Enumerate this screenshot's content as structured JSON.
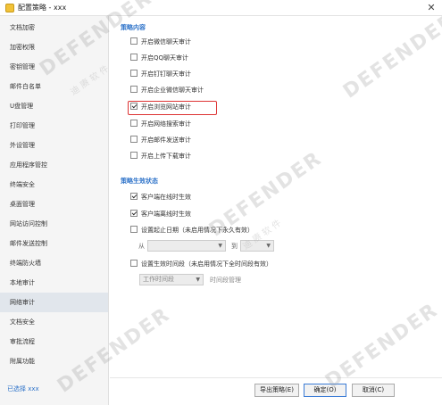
{
  "window": {
    "title": "配置策略 - xxx",
    "close_label": "✕"
  },
  "sidebar": {
    "items": [
      {
        "label": "文档加密"
      },
      {
        "label": "加密权限"
      },
      {
        "label": "密钥管理"
      },
      {
        "label": "邮件白名单"
      },
      {
        "label": "U盘管理"
      },
      {
        "label": "打印管理"
      },
      {
        "label": "外设管理"
      },
      {
        "label": "应用程序管控"
      },
      {
        "label": "终端安全"
      },
      {
        "label": "桌面管理"
      },
      {
        "label": "网站访问控制"
      },
      {
        "label": "邮件发送控制"
      },
      {
        "label": "终端防火墙"
      },
      {
        "label": "本地审计"
      },
      {
        "label": "网络审计"
      },
      {
        "label": "文档安全"
      },
      {
        "label": "审批流程"
      },
      {
        "label": "附属功能"
      }
    ],
    "active_index": 14,
    "footer": "已选择 xxx"
  },
  "policy_content": {
    "title": "策略内容",
    "items": [
      {
        "label": "开启微信聊天审计",
        "checked": false
      },
      {
        "label": "开启QQ聊天审计",
        "checked": false
      },
      {
        "label": "开启钉钉聊天审计",
        "checked": false
      },
      {
        "label": "开启企业微信聊天审计",
        "checked": false
      },
      {
        "label": "开启浏览网站审计",
        "checked": true
      },
      {
        "label": "开启网络搜索审计",
        "checked": false
      },
      {
        "label": "开启邮件发送审计",
        "checked": false
      },
      {
        "label": "开启上传下载审计",
        "checked": false
      }
    ]
  },
  "policy_status": {
    "title": "策略生效状态",
    "items": [
      {
        "label": "客户端在线时生效",
        "checked": true
      },
      {
        "label": "客户端离线时生效",
        "checked": true
      },
      {
        "label": "设置起止日期（未启用情况下永久有效）",
        "checked": false
      },
      {
        "label": "设置生效时间段（未启用情况下全时间段有效）",
        "checked": false
      }
    ],
    "date_from_label": "从",
    "date_to_label": "到",
    "time_period_select": "工作时间段",
    "time_period_manage": "时间段管理"
  },
  "buttons": {
    "export": "导出策略(E)",
    "ok": "确定(O)",
    "cancel": "取消(C)"
  },
  "watermark": {
    "text": "DEFENDER",
    "sub": "迪 赓 软 件"
  }
}
